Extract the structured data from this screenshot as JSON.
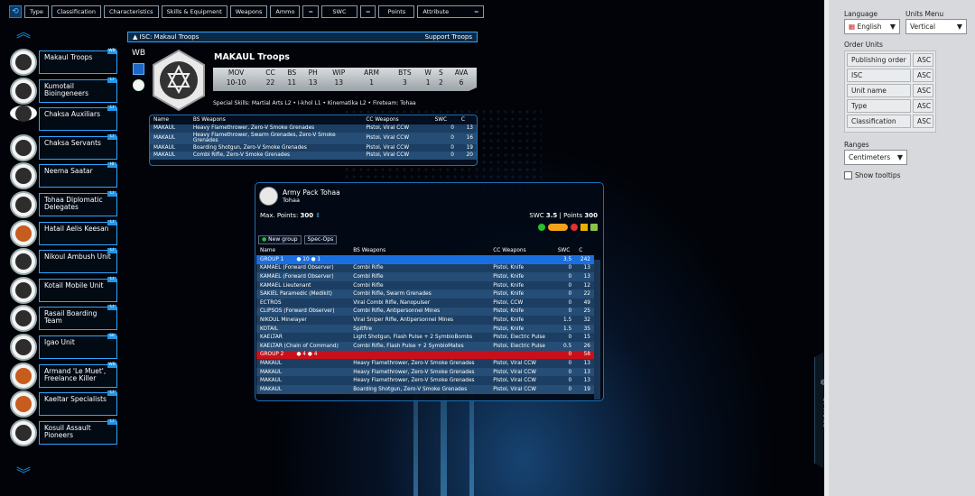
{
  "toolbar": {
    "items": [
      "Type",
      "Classification",
      "Characteristics",
      "Skills & Equipment",
      "Weapons",
      "Ammo"
    ],
    "swc": {
      "op": "=",
      "label": "SWC"
    },
    "points": {
      "op": "=",
      "label": "Points"
    },
    "attribute": {
      "label": "Attribute",
      "op": "="
    }
  },
  "units": [
    {
      "name": "Makaul Troops",
      "badge": "WB",
      "logo": "dark"
    },
    {
      "name": "Kumotail Bioingeneers",
      "badge": "LI",
      "logo": "dark"
    },
    {
      "name": "Chaksa Auxiliars",
      "badge": "LI",
      "logo": "dark"
    },
    {
      "name": "Chaksa Servants",
      "badge": "LI",
      "logo": "dark"
    },
    {
      "name": "Neema Saatar",
      "badge": "HI",
      "logo": "dark"
    },
    {
      "name": "Tohaa Diplomatic Delegates",
      "badge": "LI",
      "logo": "dark"
    },
    {
      "name": "Hatail Aelis Keesan",
      "badge": "LI",
      "logo": "orange"
    },
    {
      "name": "Nikoul Ambush Unit",
      "badge": "LI",
      "logo": "dark"
    },
    {
      "name": "Kotail Mobile Unit",
      "badge": "LI",
      "logo": "dark"
    },
    {
      "name": "Rasail Boarding Team",
      "badge": "LI",
      "logo": "dark"
    },
    {
      "name": "Igao Unit",
      "badge": "SK",
      "logo": "dark"
    },
    {
      "name": "Armand 'Le Muet', Freelance Killer",
      "badge": "WB",
      "logo": "orange"
    },
    {
      "name": "Kaeltar Specialists",
      "badge": "LI",
      "logo": "orange"
    },
    {
      "name": "Kosuil Assault Pioneers",
      "badge": "LI",
      "logo": "dark"
    }
  ],
  "isc": {
    "label": "ISC: Makaul Troops",
    "category": "Support Troops"
  },
  "unit": {
    "type": "WB",
    "name": "MAKAUL Troops",
    "stat_headers": [
      "MOV",
      "CC",
      "BS",
      "PH",
      "WIP",
      "ARM",
      "BTS",
      "W",
      "S",
      "AVA"
    ],
    "stat_values": [
      "10-10",
      "22",
      "11",
      "13",
      "13",
      "1",
      "3",
      "1",
      "2",
      "6"
    ],
    "skills": "Special Skills: Martial Arts L2 • I-khol L1 • Kinematika L2 • Fireteam: Tohaa"
  },
  "profiles": {
    "headers": [
      "Name",
      "BS Weapons",
      "CC Weapons",
      "SWC",
      "C"
    ],
    "rows": [
      [
        "MAKAUL",
        "Heavy Flamethrower, Zero-V Smoke Grenades",
        "Pistol, Viral CCW",
        "0",
        "13"
      ],
      [
        "MAKAUL",
        "Heavy Flamethrower, Swarm Grenades, Zero-V Smoke Grenades",
        "Pistol, Viral CCW",
        "0",
        "16"
      ],
      [
        "MAKAUL",
        "Boarding Shotgun, Zero-V Smoke Grenades",
        "Pistol, Viral CCW",
        "0",
        "19"
      ],
      [
        "MAKAUL",
        "Combi Rifle, Zero-V Smoke Grenades",
        "Pistol, Viral CCW",
        "0",
        "20"
      ]
    ]
  },
  "army": {
    "title": "Army Pack Tohaa",
    "subtitle": "Tohaa",
    "max_points_label": "Max. Points:",
    "max_points": "300",
    "swc_label": "SWC",
    "swc": "3.5",
    "points_label": "Points",
    "points": "300",
    "new_group": "New group",
    "spec_ops": "Spec-Ops",
    "headers": [
      "Name",
      "BS Weapons",
      "CC Weapons",
      "SWC",
      "C"
    ],
    "group1": {
      "label": "GROUP 1",
      "orders": "10",
      "irregular": "1",
      "swc": "3.5",
      "c": "242"
    },
    "group1_rows": [
      [
        "KAMAEL (Forward Observer)",
        "Combi Rifle",
        "Pistol, Knife",
        "0",
        "13"
      ],
      [
        "KAMAEL (Forward Observer)",
        "Combi Rifle",
        "Pistol, Knife",
        "0",
        "13"
      ],
      [
        "KAMAEL Lieutenant",
        "Combi Rifle",
        "Pistol, Knife",
        "0",
        "12"
      ],
      [
        "SAKIEL Paramedic (Medikit)",
        "Combi Rifle, Swarm Grenades",
        "Pistol, Knife",
        "0",
        "22"
      ],
      [
        "ECTROS",
        "Viral Combi Rifle, Nanopulser",
        "Pistol, CCW",
        "0",
        "49"
      ],
      [
        "CLIPSOS (Forward Observer)",
        "Combi Rifle, Antipersonnel Mines",
        "Pistol, Knife",
        "0",
        "25"
      ],
      [
        "NIKOUL Minelayer",
        "Viral Sniper Rifle, Antipersonnel Mines",
        "Pistol, Knife",
        "1.5",
        "32"
      ],
      [
        "KOTAIL",
        "Spitfire",
        "Pistol, Knife",
        "1.5",
        "35"
      ],
      [
        "KAELTAR",
        "Light Shotgun, Flash Pulse + 2 SymbioBombs",
        "Pistol, Electric Pulse",
        "0",
        "15"
      ],
      [
        "KAELTAR (Chain of Command)",
        "Combi Rifle, Flash Pulse + 2 SymbioMates",
        "Pistol, Electric Pulse",
        "0.5",
        "26"
      ]
    ],
    "group2": {
      "label": "GROUP 2",
      "orders": "4",
      "irregular": "4",
      "swc": "0",
      "c": "58"
    },
    "group2_rows": [
      [
        "MAKAUL",
        "Heavy Flamethrower, Zero-V Smoke Grenades",
        "Pistol, Viral CCW",
        "0",
        "13"
      ],
      [
        "MAKAUL",
        "Heavy Flamethrower, Zero-V Smoke Grenades",
        "Pistol, Viral CCW",
        "0",
        "13"
      ],
      [
        "MAKAUL",
        "Heavy Flamethrower, Zero-V Smoke Grenades",
        "Pistol, Viral CCW",
        "0",
        "13"
      ],
      [
        "MAKAUL",
        "Boarding Shotgun, Zero-V Smoke Grenades",
        "Pistol, Viral CCW",
        "0",
        "19"
      ]
    ]
  },
  "options": {
    "language_label": "Language",
    "language": "English",
    "units_menu_label": "Units Menu",
    "units_menu": "Vertical",
    "order_label": "Order Units",
    "order_rows": [
      {
        "name": "Publishing order",
        "dir": "ASC"
      },
      {
        "name": "ISC",
        "dir": "ASC"
      },
      {
        "name": "Unit name",
        "dir": "ASC"
      },
      {
        "name": "Type",
        "dir": "ASC"
      },
      {
        "name": "Classification",
        "dir": "ASC"
      }
    ],
    "ranges_label": "Ranges",
    "ranges": "Centimeters",
    "tooltips": "Show tooltips",
    "tab_label": "OPTIONS"
  },
  "colors": {
    "accent": "#2ea6ff",
    "group1": "#1a6fe0",
    "group2": "#c9101a",
    "panel": "#d7d9dc"
  }
}
